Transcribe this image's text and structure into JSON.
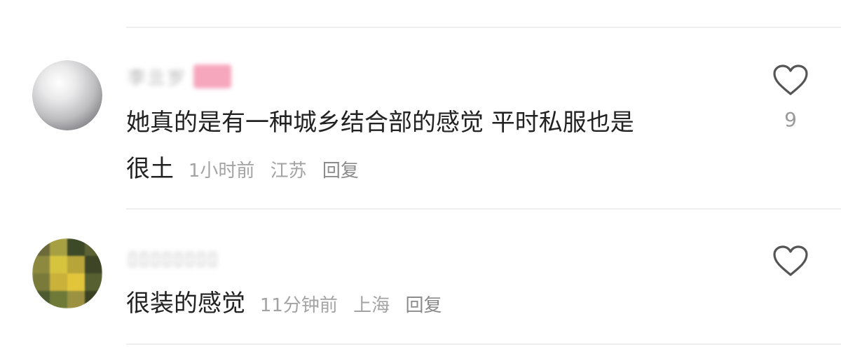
{
  "comments": [
    {
      "username": "李​亖​岁",
      "text_line1": "她真的是有一种城乡结合部的感觉  平时私服也是",
      "text_line2": "很土",
      "time": "1小时前",
      "location": "江苏",
      "reply": "回复",
      "likes": "9",
      "avatar_icon": "pearl-avatar-icon",
      "badge_color": "#f6a6bd"
    },
    {
      "username": "▯▯▯▯▯▯▯▯",
      "text_line1": "很装的感觉",
      "time": "11分钟前",
      "location": "上海",
      "reply": "回复",
      "likes": "",
      "avatar_icon": "pixelated-avatar-icon"
    }
  ],
  "like_icon": "heart-outline-icon",
  "colors": {
    "text": "#222222",
    "meta": "#a3a3a3",
    "divider": "#eeeeee",
    "icon": "#555555"
  }
}
